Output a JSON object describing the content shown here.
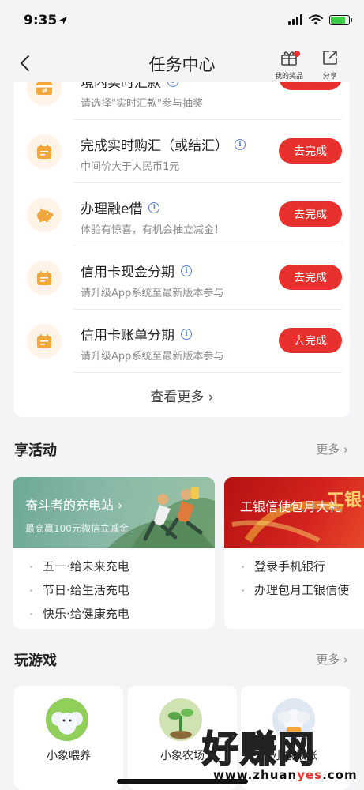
{
  "status_bar": {
    "time": "9:35"
  },
  "nav": {
    "title": "任务中心",
    "prize_label": "我的奖品",
    "share_label": "分享"
  },
  "tasks": [
    {
      "title": "境内实时汇款",
      "subtitle": "请选择\"实时汇款\"参与抽奖",
      "button": "去完成"
    },
    {
      "title": "完成实时购汇（或结汇）",
      "subtitle": "中间价大于人民币1元",
      "button": "去完成"
    },
    {
      "title": "办理融e借",
      "subtitle": "体验有惊喜，有机会抽立减金！",
      "button": "去完成"
    },
    {
      "title": "信用卡现金分期",
      "subtitle": "请升级App系统至最新版本参与",
      "button": "去完成"
    },
    {
      "title": "信用卡账单分期",
      "subtitle": "请升级App系统至最新版本参与",
      "button": "去完成"
    }
  ],
  "see_more": "查看更多 ›",
  "activities_section": {
    "title": "享活动",
    "more": "更多 ›",
    "cards": [
      {
        "banner_title": "奋斗者的充电站 ›",
        "banner_subtitle": "最高赢100元微信立减金",
        "items": [
          "五一·给未来充电",
          "节日·给生活充电",
          "快乐·给健康充电"
        ],
        "accent": "#7fb19e"
      },
      {
        "banner_title": "工银信使包月大礼",
        "banner_subtitle": "",
        "items": [
          "登录手机银行",
          "办理包月工银信使"
        ],
        "accent": "#c81c19",
        "banner_overlay": "工银包月"
      }
    ]
  },
  "games_section": {
    "title": "玩游戏",
    "more": "更多 ›",
    "games": [
      {
        "label": "小象喂养"
      },
      {
        "label": "小象农场"
      },
      {
        "label": "小象报账"
      }
    ]
  },
  "watermark": {
    "big": "好赚网",
    "small_prefix": "www.zhuan",
    "small_accent": "yes",
    "small_suffix": ".com"
  },
  "colors": {
    "accent_red": "#e8312f",
    "page_bg": "#f4f4f6",
    "icon_orange": "#f2a73b",
    "info_blue": "#5a7fd6"
  }
}
